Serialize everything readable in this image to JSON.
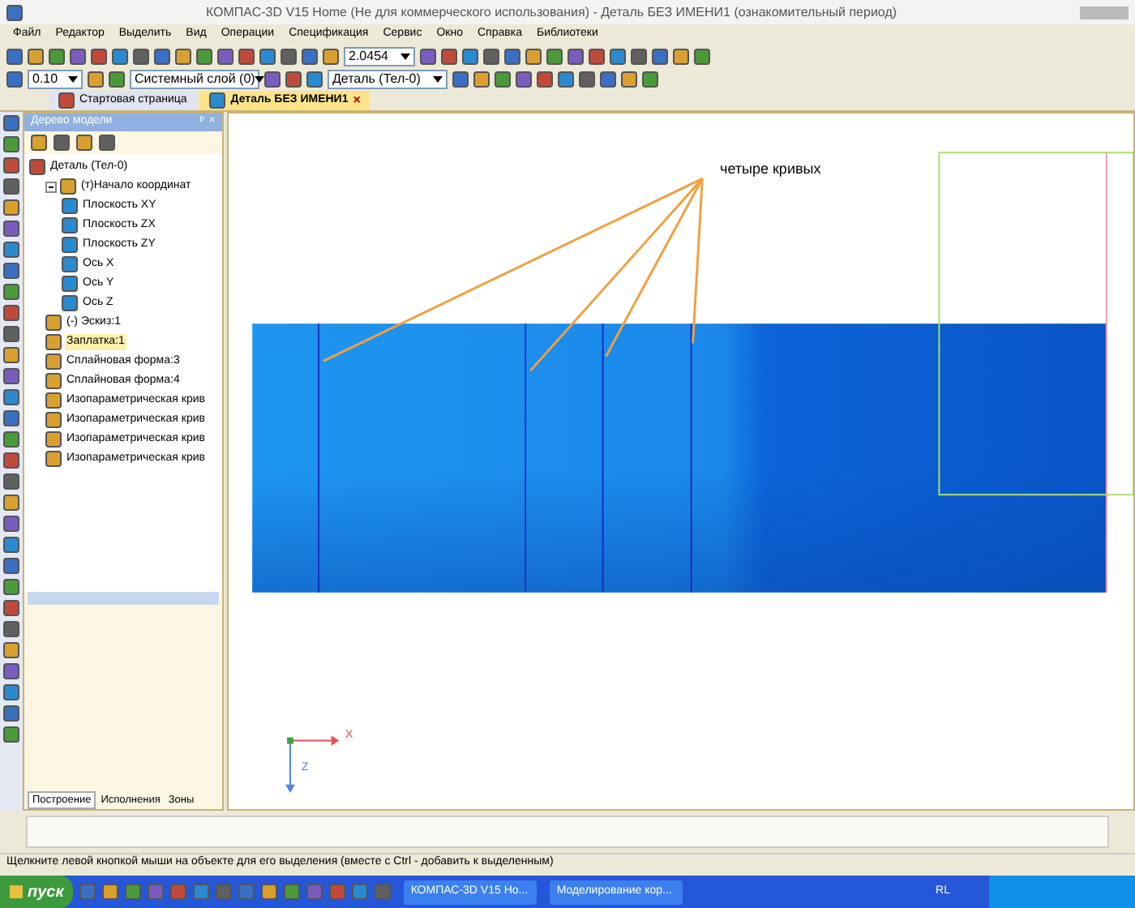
{
  "window": {
    "title": "КОМПАС-3D V15 Home (Не для коммерческого использования) - Деталь БЕЗ ИМЕНИ1 (ознакомительный период)"
  },
  "menu": [
    "Файл",
    "Редактор",
    "Выделить",
    "Вид",
    "Операции",
    "Спецификация",
    "Сервис",
    "Окно",
    "Справка",
    "Библиотеки"
  ],
  "toolbar": {
    "scale": "2.0454",
    "step": "0.10",
    "layer": "Системный слой (0)",
    "body": "Деталь (Тел-0)"
  },
  "tabs": [
    {
      "label": "Стартовая страница",
      "selected": false
    },
    {
      "label": "Деталь БЕЗ ИМЕНИ1",
      "selected": true,
      "close": "×"
    }
  ],
  "tree_panel": {
    "title": "Дерево модели",
    "close": "×",
    "pin": "ᵖ",
    "items": [
      {
        "label": "Деталь (Тел-0)",
        "selected": false,
        "children": [
          {
            "label": "(т)Начало координат",
            "selected": false,
            "children": [
              {
                "label": "Плоскость XY",
                "selected": false
              },
              {
                "label": "Плоскость ZX",
                "selected": false
              },
              {
                "label": "Плоскость ZY",
                "selected": false
              },
              {
                "label": "Ось X",
                "selected": false
              },
              {
                "label": "Ось Y",
                "selected": false
              },
              {
                "label": "Ось Z",
                "selected": false
              }
            ]
          },
          {
            "label": "(-) Эскиз:1",
            "selected": false
          },
          {
            "label": "Заплатка:1",
            "selected": true
          },
          {
            "label": "Сплайновая форма:3",
            "selected": false
          },
          {
            "label": "Сплайновая форма:4",
            "selected": false
          },
          {
            "label": "Изопараметрическая крив",
            "selected": false
          },
          {
            "label": "Изопараметрическая крив",
            "selected": false
          },
          {
            "label": "Изопараметрическая крив",
            "selected": false
          },
          {
            "label": "Изопараметрическая крив",
            "selected": false
          }
        ]
      }
    ],
    "tabs": [
      {
        "label": "Построение",
        "selected": true
      },
      {
        "label": "Исполнения",
        "selected": false
      },
      {
        "label": "Зоны",
        "selected": false
      }
    ]
  },
  "canvas": {
    "annotation": "четыре кривых",
    "axis_labels": [
      "X",
      "Z"
    ]
  },
  "status_bar": "Щелкните левой кнопкой мыши на объекте для его выделения (вместе с Ctrl - добавить к выделенным)",
  "taskbar": {
    "start": "пуск",
    "tasks": [
      {
        "label": "КОМПАС-3D V15 Ho...",
        "selected": false
      },
      {
        "label": "Моделирование кор...",
        "selected": false
      }
    ],
    "language": "RL"
  }
}
